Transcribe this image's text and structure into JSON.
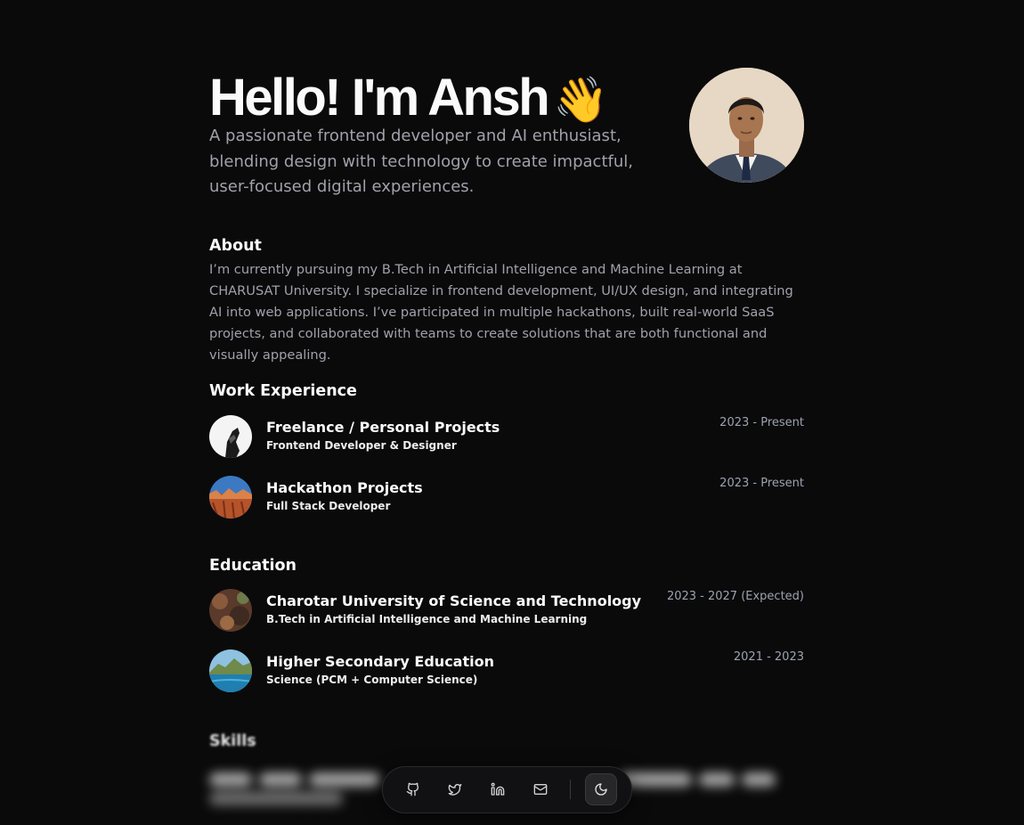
{
  "hero": {
    "title": "Hello! I'm Ansh",
    "emoji": "👋",
    "subtitle": "A passionate frontend developer and AI enthusiast, blending design with technology to create impactful, user-focused digital experiences."
  },
  "about": {
    "heading": "About",
    "text": "I’m currently pursuing my B.Tech in Artificial Intelligence and Machine Learning at CHARUSAT University. I specialize in frontend development, UI/UX design, and integrating AI into web applications. I’ve participated in multiple hackathons, built real-world SaaS projects, and collaborated with teams to create solutions that are both functional and visually appealing."
  },
  "work": {
    "heading": "Work Experience",
    "items": [
      {
        "name": "Freelance / Personal Projects",
        "role": "Frontend Developer & Designer",
        "date": "2023 - Present"
      },
      {
        "name": "Hackathon Projects",
        "role": "Full Stack Developer",
        "date": "2023 - Present"
      }
    ]
  },
  "education": {
    "heading": "Education",
    "items": [
      {
        "name": "Charotar University of Science and Technology",
        "role": "B.Tech in Artificial Intelligence and Machine Learning",
        "date": "2023 - 2027 (Expected)"
      },
      {
        "name": "Higher Secondary Education",
        "role": "Science (PCM + Computer Science)",
        "date": "2021 - 2023"
      }
    ]
  },
  "skills": {
    "heading": "Skills"
  },
  "dock": {
    "icons": [
      "github-icon",
      "twitter-icon",
      "linkedin-icon",
      "mail-icon",
      "moon-icon"
    ]
  },
  "colors": {
    "background": "#0a0a0b",
    "muted_text": "#a1a1aa",
    "text": "#fafafa"
  }
}
